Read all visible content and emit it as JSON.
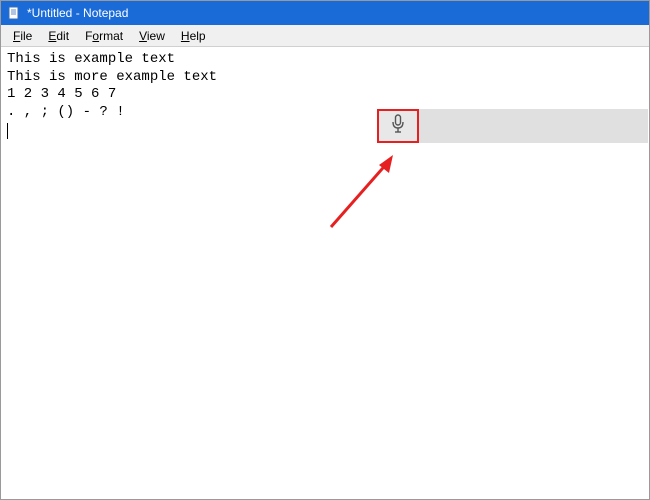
{
  "title": "*Untitled - Notepad",
  "menu": {
    "file": "File",
    "edit": "Edit",
    "format": "Format",
    "view": "View",
    "help": "Help"
  },
  "editor": {
    "content": "This is example text\nThis is more example text\n1 2 3 4 5 6 7\n. , ; () - ? !"
  },
  "annotation": {
    "color": "#e62020"
  }
}
